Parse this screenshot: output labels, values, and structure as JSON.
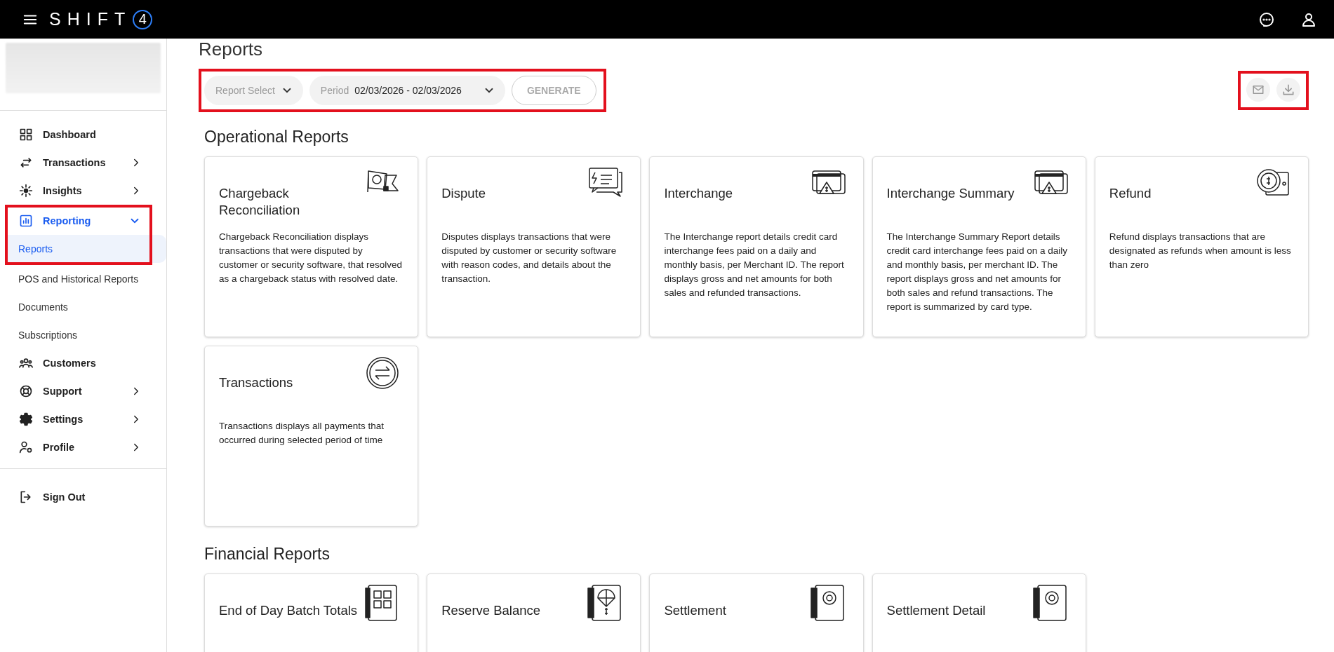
{
  "header": {
    "logo": "SHIFT",
    "logo_mark": "4"
  },
  "sidebar": {
    "items": [
      {
        "label": "Dashboard",
        "selected": false
      },
      {
        "label": "Transactions",
        "selected": false,
        "expanded": false
      },
      {
        "label": "Insights",
        "selected": false,
        "expanded": false
      },
      {
        "label": "Reporting",
        "selected": true,
        "expanded": true,
        "highlighted": true,
        "children": [
          {
            "label": "Reports",
            "selected": true
          },
          {
            "label": "POS and Historical Reports",
            "selected": false
          },
          {
            "label": "Documents",
            "selected": false
          },
          {
            "label": "Subscriptions",
            "selected": false
          }
        ]
      },
      {
        "label": "Customers",
        "selected": false
      },
      {
        "label": "Support",
        "selected": false,
        "expanded": false
      },
      {
        "label": "Settings",
        "selected": false,
        "expanded": false
      },
      {
        "label": "Profile",
        "selected": false,
        "expanded": false
      }
    ],
    "sign_out": "Sign Out"
  },
  "page": {
    "title": "Reports",
    "filters": {
      "highlighted": true,
      "report_select": {
        "placeholder": "Report Select"
      },
      "period": {
        "label": "Period",
        "value": "02/03/2026 - 02/03/2026"
      },
      "generate": {
        "label": "GENERATE",
        "disabled": true
      }
    },
    "actions": {
      "highlighted": true
    },
    "sections": [
      {
        "title": "Operational Reports",
        "cards": [
          {
            "title": "Chargeback Reconciliation",
            "description": "Chargeback Reconciliation displays transactions that were disputed by customer or security software, that resolved as a chargeback status with resolved date."
          },
          {
            "title": "Dispute",
            "description": "Disputes displays transactions that were disputed by customer or security software with reason codes, and details about the transaction."
          },
          {
            "title": "Interchange",
            "description": "The Interchange report details credit card interchange fees paid on a daily and monthly basis, per Merchant ID. The report displays gross and net amounts for both sales and refunded transactions."
          },
          {
            "title": "Interchange Summary",
            "description": "The Interchange Summary Report details credit card interchange fees paid on a daily and monthly basis, per merchant ID. The report displays gross and net amounts for both sales and refund transactions. The report is summarized by card type."
          },
          {
            "title": "Refund",
            "description": "Refund displays transactions that are designated as refunds when amount is less than zero"
          },
          {
            "title": "Transactions",
            "description": "Transactions displays all payments that occurred during selected period of time"
          }
        ]
      },
      {
        "title": "Financial Reports",
        "cards": [
          {
            "title": "End of Day Batch Totals"
          },
          {
            "title": "Reserve Balance"
          },
          {
            "title": "Settlement"
          },
          {
            "title": "Settlement Detail"
          }
        ]
      }
    ]
  }
}
